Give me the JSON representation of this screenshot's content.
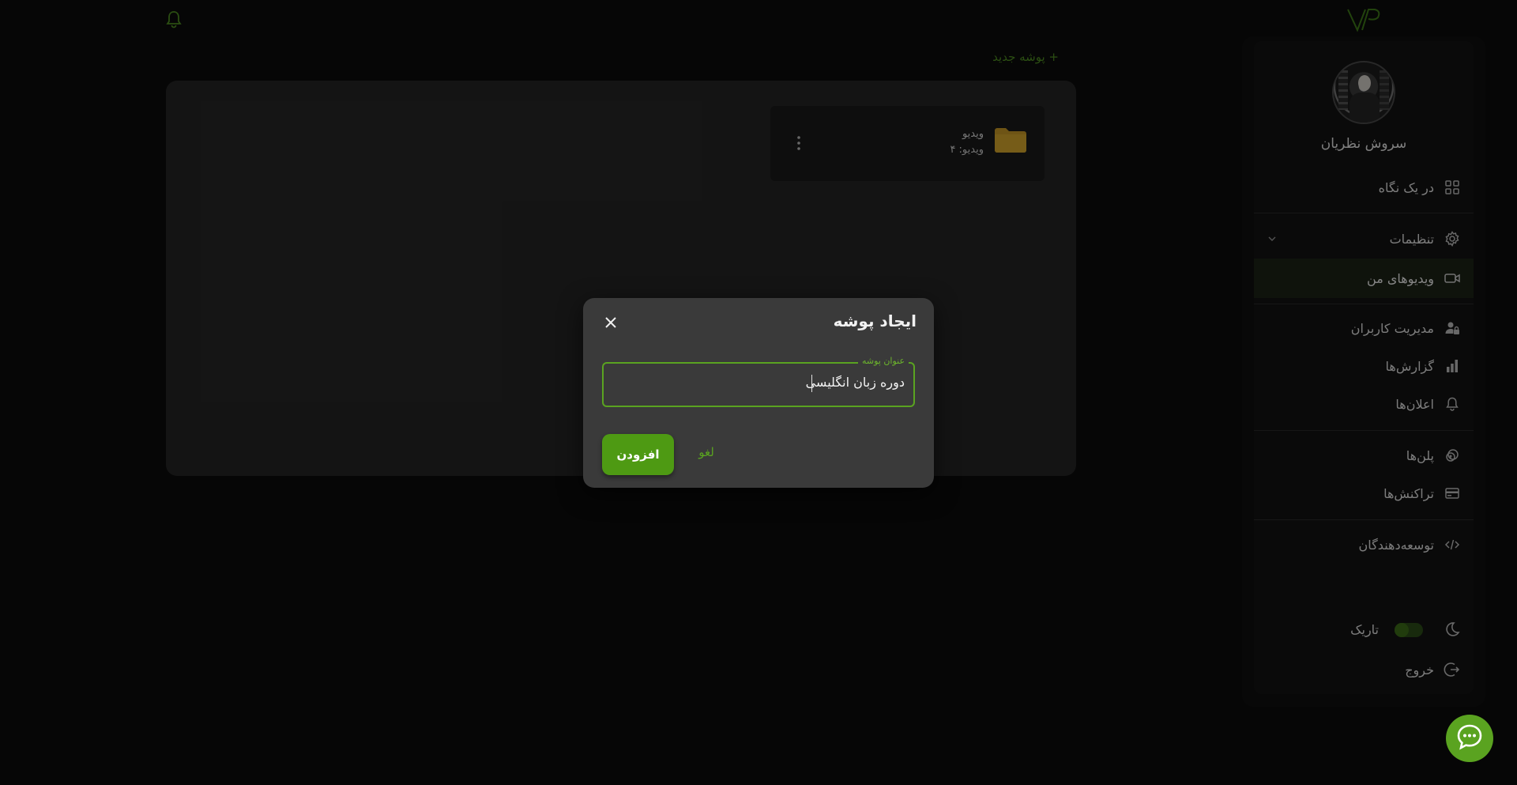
{
  "header": {
    "notifications_icon": "bell-icon",
    "logo_icon": "vp-logo"
  },
  "user": {
    "name": "سروش نظریان"
  },
  "sidebar": {
    "items": [
      {
        "label": "در یک نگاه",
        "icon": "grid-icon"
      },
      {
        "label": "تنظیمات",
        "icon": "gear-icon"
      },
      {
        "label": "ویدیوهای من",
        "icon": "video-icon",
        "active": true
      },
      {
        "label": "مدیریت کاربران",
        "icon": "user-lock-icon"
      },
      {
        "label": "گزارش‌ها",
        "icon": "bar-chart-icon"
      },
      {
        "label": "اعلان‌ها",
        "icon": "bell-icon"
      },
      {
        "label": "پلن‌ها",
        "icon": "plans-icon"
      },
      {
        "label": "تراکنش‌ها",
        "icon": "card-icon"
      },
      {
        "label": "توسعه‌دهندگان",
        "icon": "code-icon"
      }
    ],
    "dark_mode": {
      "label": "تاریک",
      "enabled": false
    },
    "logout": {
      "label": "خروج"
    }
  },
  "main": {
    "new_folder_label": "+ پوشه جدید",
    "folders": [
      {
        "name": "ویدیو",
        "count_text": "ویدیو: ۴"
      }
    ]
  },
  "dialog": {
    "title": "ایجاد پوشه",
    "field_label": "عنوان پوشه",
    "field_value": "دوره زبان انگلیسی",
    "add_label": "افزودن",
    "cancel_label": "لغو"
  },
  "colors": {
    "accent": "#5aa320",
    "background": "#0b0b0b",
    "panel": "#262626",
    "folder": "#c99a27"
  }
}
